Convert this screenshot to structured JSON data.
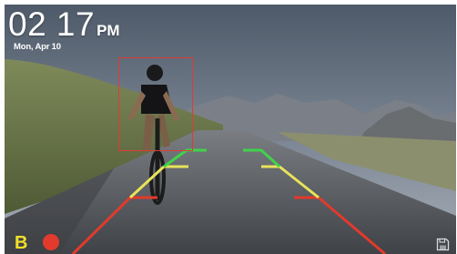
{
  "status": {
    "time": "02 17",
    "ampm": "PM",
    "date": "Mon, Apr 10"
  },
  "indicators": {
    "mode_letter": "B",
    "recording": true
  },
  "icons": {
    "record": "record-dot-icon",
    "save": "save-disk-icon"
  },
  "colors": {
    "guide_near": "#e23a2c",
    "guide_mid": "#e8e35a",
    "guide_far": "#3fd34a",
    "detection_box": "#e03b36",
    "mode_letter": "#f3e02a"
  }
}
